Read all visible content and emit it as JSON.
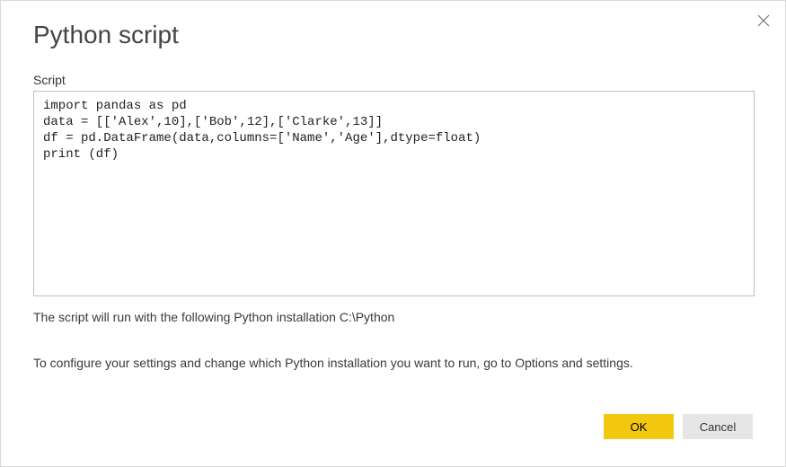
{
  "dialog": {
    "title": "Python script",
    "close_label": "Close"
  },
  "script": {
    "label": "Script",
    "value": "import pandas as pd\ndata = [['Alex',10],['Bob',12],['Clarke',13]]\ndf = pd.DataFrame(data,columns=['Name','Age'],dtype=float)\nprint (df)"
  },
  "notes": {
    "installation": "The script will run with the following Python installation C:\\Python",
    "configure": "To configure your settings and change which Python installation you want to run, go to Options and settings."
  },
  "buttons": {
    "ok": "OK",
    "cancel": "Cancel"
  },
  "colors": {
    "accent": "#F2C811",
    "secondary": "#e6e6e6",
    "border": "#bfbfbf"
  }
}
